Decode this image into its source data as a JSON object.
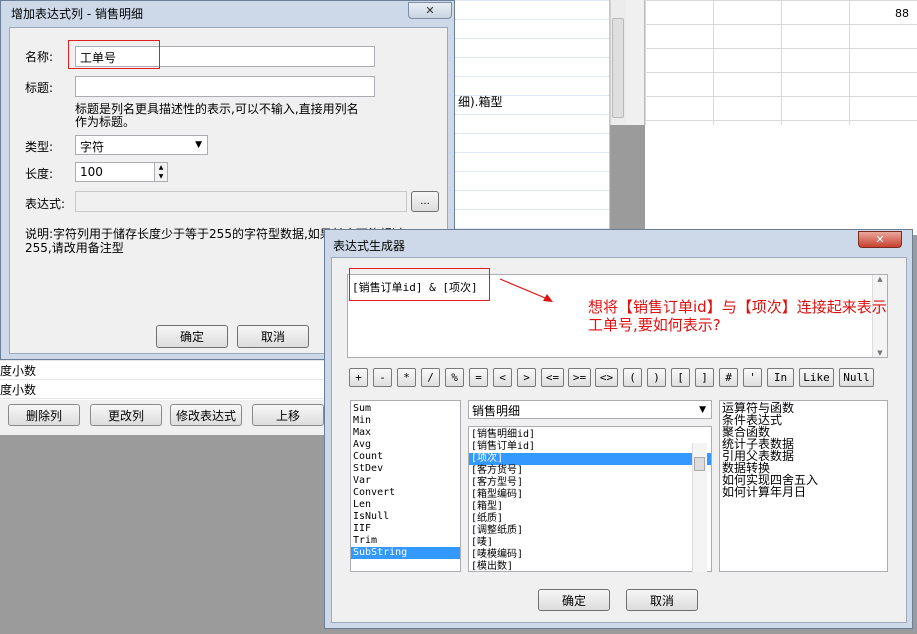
{
  "background": {
    "number_cell": "88",
    "mid_text": "细).箱型",
    "list_rows": [
      "度小数",
      "度小数"
    ],
    "buttons": [
      "删除列",
      "更改列",
      "修改表达式",
      "上移"
    ]
  },
  "dialog1": {
    "title": "增加表达式列 - 销售明细",
    "close_symbol": "✕",
    "name_label": "名称:",
    "name_value": "工单号",
    "caption_label": "标题:",
    "caption_value": "",
    "caption_note_line1": "标题是列名更具描述性的表示,可以不输入,直接用列名",
    "caption_note_line2": "作为标题。",
    "type_label": "类型:",
    "type_value": "字符",
    "length_label": "长度:",
    "length_value": "100",
    "expr_label": "表达式:",
    "expr_value": "",
    "expr_button": "...",
    "help_line1": "说明:字符列用于储存长度少于等于255的字符型数据,如果长度可能超过",
    "help_line2": "255,请改用备注型",
    "ok": "确定",
    "cancel": "取消"
  },
  "dialog2": {
    "title": "表达式生成器",
    "close_symbol": "✕",
    "expression": "[销售订单id] & [项次]",
    "operators": [
      "+",
      "-",
      "*",
      "/",
      "%",
      "=",
      "<",
      ">",
      "<=",
      ">=",
      "<>",
      "(",
      ")",
      "[",
      "]",
      "#",
      "'",
      "In",
      "Like",
      "Null"
    ],
    "functions": [
      "Sum",
      "Min",
      "Max",
      "Avg",
      "Count",
      "StDev",
      "Var",
      "Convert",
      "Len",
      "IsNull",
      "IIF",
      "Trim",
      "SubString"
    ],
    "functions_selected": "SubString",
    "table_select": "销售明细",
    "fields": [
      "[销售明细id]",
      "[销售订单id]",
      "[项次]",
      "[客方货号]",
      "[客方型号]",
      "[箱型编码]",
      "[箱型]",
      "[纸质]",
      "[调整纸质]",
      "[唛]",
      "[唛模编码]",
      "[模出数]"
    ],
    "fields_selected": "[项次]",
    "help_topics": [
      "运算符与函数",
      "条件表达式",
      "聚合函数",
      "统计子表数据",
      "引用父表数据",
      "数据转换",
      "如何实现四舍五入",
      "如何计算年月日"
    ],
    "ok": "确定",
    "cancel": "取消"
  },
  "annotation": {
    "line1": "想将【销售订单id】与【项次】连接起来表示",
    "line2": "工单号,要如何表示?",
    "color": "#e01010"
  }
}
